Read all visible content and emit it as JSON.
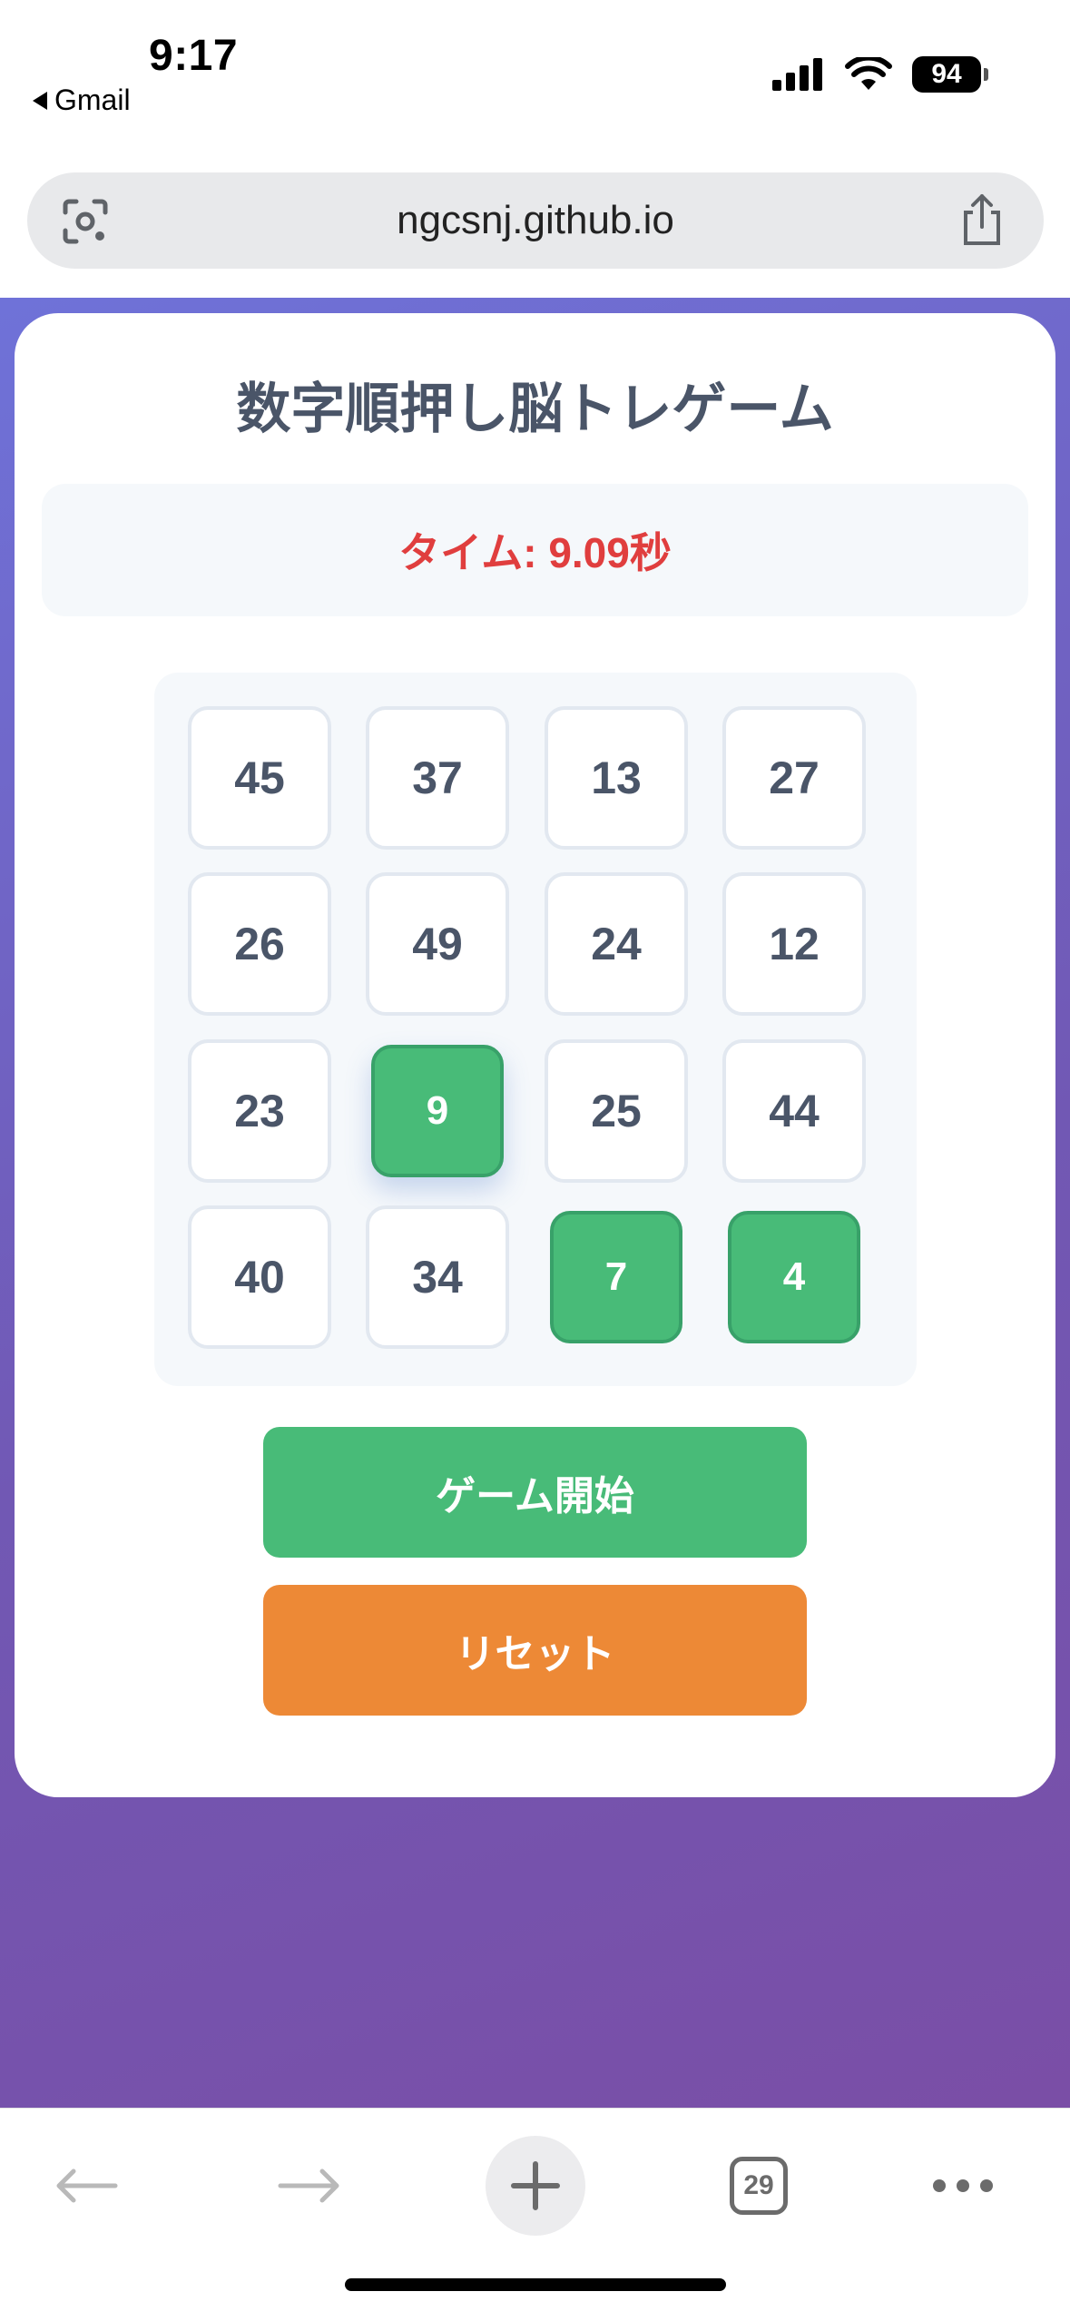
{
  "status_bar": {
    "time": "9:17",
    "back_app": "Gmail",
    "battery": "94"
  },
  "browser": {
    "url": "ngcsnj.github.io",
    "tab_count": "29"
  },
  "game": {
    "title": "数字順押し脳トレゲーム",
    "timer": "タイム: 9.09秒",
    "tiles": [
      {
        "label": "45",
        "done": false
      },
      {
        "label": "37",
        "done": false
      },
      {
        "label": "13",
        "done": false
      },
      {
        "label": "27",
        "done": false
      },
      {
        "label": "26",
        "done": false
      },
      {
        "label": "49",
        "done": false
      },
      {
        "label": "24",
        "done": false
      },
      {
        "label": "12",
        "done": false
      },
      {
        "label": "23",
        "done": false
      },
      {
        "label": "9",
        "done": true
      },
      {
        "label": "25",
        "done": false
      },
      {
        "label": "44",
        "done": false
      },
      {
        "label": "40",
        "done": false
      },
      {
        "label": "34",
        "done": false
      },
      {
        "label": "7",
        "done": true
      },
      {
        "label": "4",
        "done": true
      }
    ],
    "start_label": "ゲーム開始",
    "reset_label": "リセット"
  },
  "colors": {
    "tile_done": "#48bb78",
    "start_button": "#48bb78",
    "reset_button": "#ed8936",
    "timer_text": "#e03e3e"
  },
  "icons": {
    "url_left": "lens-icon",
    "url_right": "share-icon",
    "toolbar": [
      "back-arrow-icon",
      "forward-arrow-icon",
      "new-tab-plus-icon",
      "tabs-icon",
      "more-icon"
    ]
  }
}
